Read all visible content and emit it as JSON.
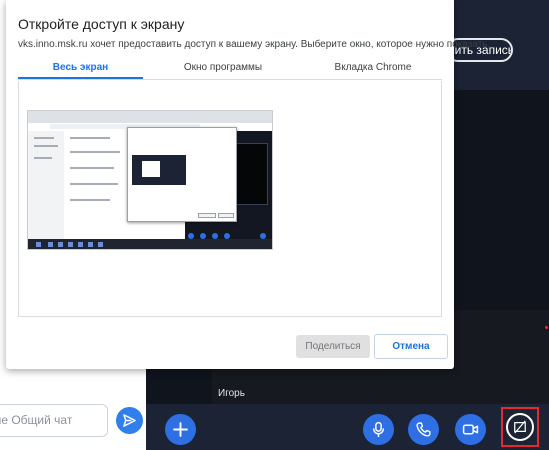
{
  "dialog": {
    "title": "Откройте доступ к экрану",
    "description": "vks.inno.msk.ru хочет предоставить доступ к вашему экрану. Выберите окно, которое нужно показать.",
    "tabs": [
      {
        "label": "Весь экран",
        "active": true
      },
      {
        "label": "Окно программы",
        "active": false
      },
      {
        "label": "Вкладка Chrome",
        "active": false
      }
    ],
    "share_label": "Поделиться",
    "cancel_label": "Отмена"
  },
  "conference": {
    "record_label": "нить запись",
    "participant_name": "Игорь",
    "chat_placeholder": "ние Общий чат"
  },
  "icons": {
    "send": "send-icon",
    "add": "plus-icon",
    "mic": "microphone-icon",
    "call": "phone-icon",
    "camera": "video-camera-icon",
    "share": "screen-share-icon"
  },
  "colors": {
    "accent": "#1a73e8",
    "control_blue": "#2f6fe4",
    "dark_bg": "#1b2335",
    "video_bg": "#10141d",
    "highlight": "#e52a2a"
  }
}
